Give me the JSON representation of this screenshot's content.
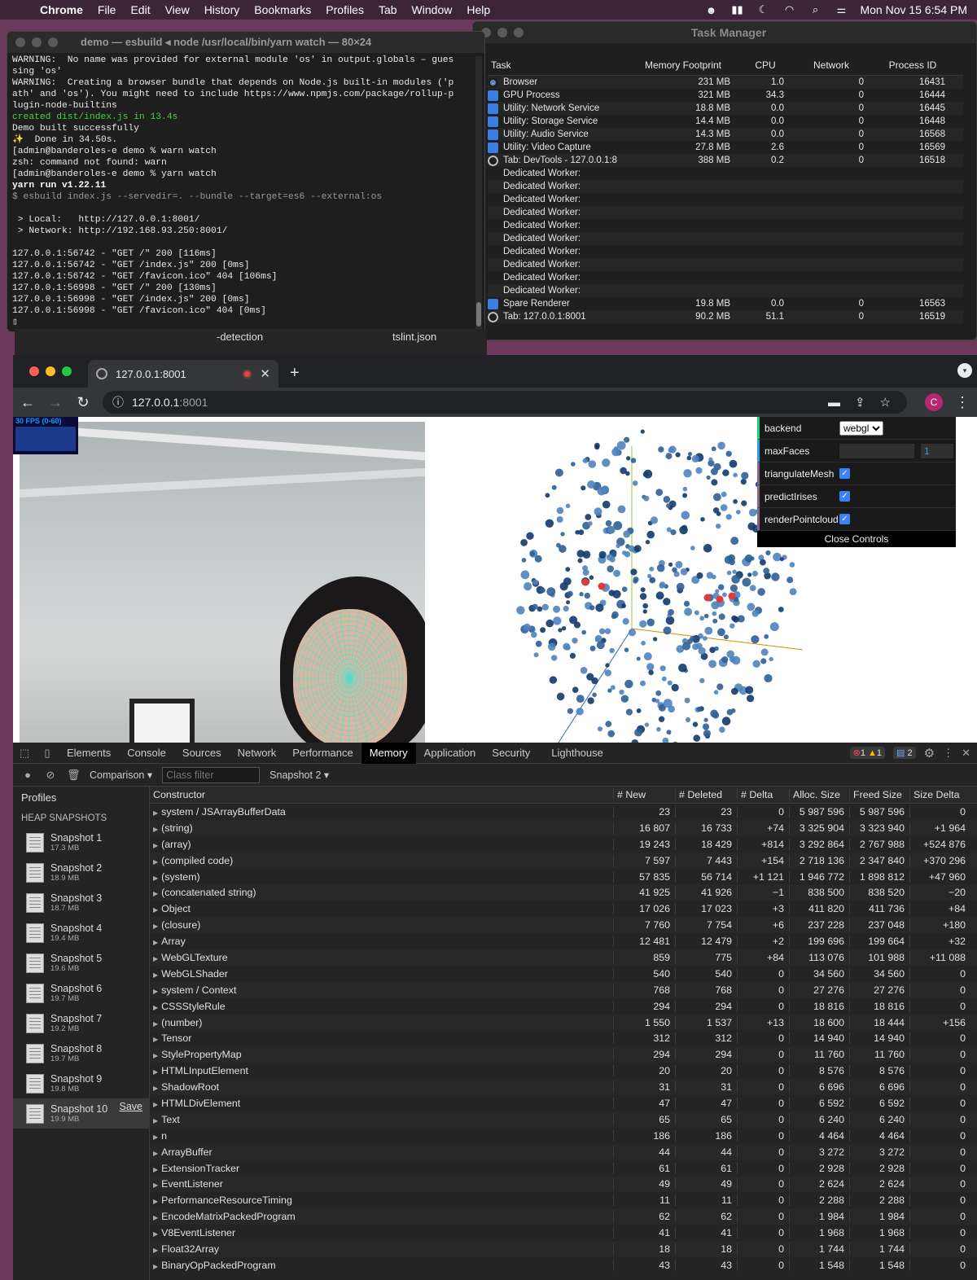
{
  "menubar": {
    "app": "Chrome",
    "items": [
      "File",
      "Edit",
      "View",
      "History",
      "Bookmarks",
      "Profiles",
      "Tab",
      "Window",
      "Help"
    ],
    "clock": "Mon Nov 15  6:54 PM"
  },
  "terminal": {
    "title": "demo — esbuild ◂ node /usr/local/bin/yarn watch — 80×24",
    "lines": [
      {
        "t": "WARNING:  No name was provided for external module 'os' in output.globals – gues",
        "c": ""
      },
      {
        "t": "sing 'os'",
        "c": ""
      },
      {
        "t": "WARNING:  Creating a browser bundle that depends on Node.js built-in modules ('p",
        "c": ""
      },
      {
        "t": "ath' and 'os'). You might need to include https://www.npmjs.com/package/rollup-p",
        "c": ""
      },
      {
        "t": "lugin-node-builtins",
        "c": ""
      },
      {
        "t": "created dist/index.js in 13.4s",
        "c": "t-green"
      },
      {
        "t": "Demo built successfully",
        "c": ""
      },
      {
        "t": "✨  Done in 34.50s.",
        "c": ""
      },
      {
        "t": "[admin@banderoles-e demo % warn watch",
        "c": ""
      },
      {
        "t": "zsh: command not found: warn",
        "c": ""
      },
      {
        "t": "[admin@banderoles-e demo % yarn watch",
        "c": ""
      },
      {
        "t": "yarn run v1.22.11",
        "c": "t-bold"
      },
      {
        "t": "$ esbuild index.js --servedir=. --bundle --target=es6 --external:os",
        "c": "t-gray"
      },
      {
        "t": "",
        "c": ""
      },
      {
        "t": " > Local:   http://127.0.0.1:8001/",
        "c": ""
      },
      {
        "t": " > Network: http://192.168.93.250:8001/",
        "c": ""
      },
      {
        "t": "",
        "c": ""
      },
      {
        "t": "127.0.0.1:56742 - \"GET /\" 200 [116ms]",
        "c": ""
      },
      {
        "t": "127.0.0.1:56742 - \"GET /index.js\" 200 [0ms]",
        "c": ""
      },
      {
        "t": "127.0.0.1:56742 - \"GET /favicon.ico\" 404 [106ms]",
        "c": ""
      },
      {
        "t": "127.0.0.1:56998 - \"GET /\" 200 [130ms]",
        "c": ""
      },
      {
        "t": "127.0.0.1:56998 - \"GET /index.js\" 200 [0ms]",
        "c": ""
      },
      {
        "t": "127.0.0.1:56998 - \"GET /favicon.ico\" 404 [0ms]",
        "c": ""
      },
      {
        "t": "▯",
        "c": ""
      }
    ]
  },
  "taskmgr": {
    "title": "Task Manager",
    "columns": [
      "Task",
      "Memory Footprint",
      "CPU",
      "Network",
      "Process ID"
    ],
    "rows": [
      {
        "icon": "chrome",
        "task": "Browser",
        "mem": "231 MB",
        "cpu": "1.0",
        "net": "0",
        "pid": "16431"
      },
      {
        "icon": "puzzle",
        "task": "GPU Process",
        "mem": "321 MB",
        "cpu": "34.3",
        "net": "0",
        "pid": "16444"
      },
      {
        "icon": "puzzle",
        "task": "Utility: Network Service",
        "mem": "18.8 MB",
        "cpu": "0.0",
        "net": "0",
        "pid": "16445"
      },
      {
        "icon": "puzzle",
        "task": "Utility: Storage Service",
        "mem": "14.4 MB",
        "cpu": "0.0",
        "net": "0",
        "pid": "16448"
      },
      {
        "icon": "puzzle",
        "task": "Utility: Audio Service",
        "mem": "14.3 MB",
        "cpu": "0.0",
        "net": "0",
        "pid": "16568"
      },
      {
        "icon": "puzzle",
        "task": "Utility: Video Capture",
        "mem": "27.8 MB",
        "cpu": "2.6",
        "net": "0",
        "pid": "16569"
      },
      {
        "icon": "globe",
        "task": "Tab: DevTools - 127.0.0.1:8",
        "mem": "388 MB",
        "cpu": "0.2",
        "net": "0",
        "pid": "16518"
      },
      {
        "icon": "none",
        "task": "Dedicated Worker:",
        "mem": "",
        "cpu": "",
        "net": "",
        "pid": ""
      },
      {
        "icon": "none",
        "task": "Dedicated Worker:",
        "mem": "",
        "cpu": "",
        "net": "",
        "pid": ""
      },
      {
        "icon": "none",
        "task": "Dedicated Worker:",
        "mem": "",
        "cpu": "",
        "net": "",
        "pid": ""
      },
      {
        "icon": "none",
        "task": "Dedicated Worker:",
        "mem": "",
        "cpu": "",
        "net": "",
        "pid": ""
      },
      {
        "icon": "none",
        "task": "Dedicated Worker:",
        "mem": "",
        "cpu": "",
        "net": "",
        "pid": ""
      },
      {
        "icon": "none",
        "task": "Dedicated Worker:",
        "mem": "",
        "cpu": "",
        "net": "",
        "pid": ""
      },
      {
        "icon": "none",
        "task": "Dedicated Worker:",
        "mem": "",
        "cpu": "",
        "net": "",
        "pid": ""
      },
      {
        "icon": "none",
        "task": "Dedicated Worker:",
        "mem": "",
        "cpu": "",
        "net": "",
        "pid": ""
      },
      {
        "icon": "none",
        "task": "Dedicated Worker:",
        "mem": "",
        "cpu": "",
        "net": "",
        "pid": ""
      },
      {
        "icon": "none",
        "task": "Dedicated Worker:",
        "mem": "",
        "cpu": "",
        "net": "",
        "pid": ""
      },
      {
        "icon": "puzzle",
        "task": "Spare Renderer",
        "mem": "19.8 MB",
        "cpu": "0.0",
        "net": "0",
        "pid": "16563"
      },
      {
        "icon": "globe",
        "task": "Tab: 127.0.0.1:8001",
        "mem": "90.2 MB",
        "cpu": "51.1",
        "net": "0",
        "pid": "16519"
      }
    ]
  },
  "background": {
    "frag1": "-detection",
    "frag2": "tslint.json"
  },
  "browser": {
    "tab_title": "127.0.0.1:8001",
    "url_host": "127.0.0.1",
    "url_port": ":8001",
    "avatar_letter": "C"
  },
  "demo": {
    "fps_label": "30 FPS (0-60)",
    "controls": {
      "backend_label": "backend",
      "backend_value": "webgl",
      "maxfaces_label": "maxFaces",
      "maxfaces_value": "1",
      "triangulate_label": "triangulateMesh",
      "irises_label": "predictIrises",
      "pointcloud_label": "renderPointcloud",
      "close_label": "Close Controls"
    }
  },
  "devtools": {
    "tabs": [
      "Elements",
      "Console",
      "Sources",
      "Network",
      "Performance",
      "Memory",
      "Application",
      "Security",
      "Lighthouse"
    ],
    "active_tab": "Memory",
    "errors": "1",
    "warnings": "1",
    "messages": "2",
    "view_mode": "Comparison",
    "filter_placeholder": "Class filter",
    "base_snapshot": "Snapshot 2",
    "profiles_title": "Profiles",
    "section_title": "HEAP SNAPSHOTS",
    "save_label": "Save",
    "snapshots": [
      {
        "name": "Snapshot 1",
        "size": "17.3 MB"
      },
      {
        "name": "Snapshot 2",
        "size": "18.9 MB"
      },
      {
        "name": "Snapshot 3",
        "size": "18.7 MB"
      },
      {
        "name": "Snapshot 4",
        "size": "19.4 MB"
      },
      {
        "name": "Snapshot 5",
        "size": "19.6 MB"
      },
      {
        "name": "Snapshot 6",
        "size": "19.7 MB"
      },
      {
        "name": "Snapshot 7",
        "size": "19.2 MB"
      },
      {
        "name": "Snapshot 8",
        "size": "19.7 MB"
      },
      {
        "name": "Snapshot 9",
        "size": "19.8 MB"
      },
      {
        "name": "Snapshot 10",
        "size": "19.9 MB"
      }
    ],
    "columns": [
      "Constructor",
      "# New",
      "# Deleted",
      "# Delta",
      "Alloc. Size",
      "Freed Size",
      "Size Delta"
    ],
    "rows": [
      [
        "system / JSArrayBufferData",
        "23",
        "23",
        "0",
        "5 987 596",
        "5 987 596",
        "0"
      ],
      [
        "(string)",
        "16 807",
        "16 733",
        "+74",
        "3 325 904",
        "3 323 940",
        "+1 964"
      ],
      [
        "(array)",
        "19 243",
        "18 429",
        "+814",
        "3 292 864",
        "2 767 988",
        "+524 876"
      ],
      [
        "(compiled code)",
        "7 597",
        "7 443",
        "+154",
        "2 718 136",
        "2 347 840",
        "+370 296"
      ],
      [
        "(system)",
        "57 835",
        "56 714",
        "+1 121",
        "1 946 772",
        "1 898 812",
        "+47 960"
      ],
      [
        "(concatenated string)",
        "41 925",
        "41 926",
        "−1",
        "838 500",
        "838 520",
        "−20"
      ],
      [
        "Object",
        "17 026",
        "17 023",
        "+3",
        "411 820",
        "411 736",
        "+84"
      ],
      [
        "(closure)",
        "7 760",
        "7 754",
        "+6",
        "237 228",
        "237 048",
        "+180"
      ],
      [
        "Array",
        "12 481",
        "12 479",
        "+2",
        "199 696",
        "199 664",
        "+32"
      ],
      [
        "WebGLTexture",
        "859",
        "775",
        "+84",
        "113 076",
        "101 988",
        "+11 088"
      ],
      [
        "WebGLShader",
        "540",
        "540",
        "0",
        "34 560",
        "34 560",
        "0"
      ],
      [
        "system / Context",
        "768",
        "768",
        "0",
        "27 276",
        "27 276",
        "0"
      ],
      [
        "CSSStyleRule",
        "294",
        "294",
        "0",
        "18 816",
        "18 816",
        "0"
      ],
      [
        "(number)",
        "1 550",
        "1 537",
        "+13",
        "18 600",
        "18 444",
        "+156"
      ],
      [
        "Tensor",
        "312",
        "312",
        "0",
        "14 940",
        "14 940",
        "0"
      ],
      [
        "StylePropertyMap",
        "294",
        "294",
        "0",
        "11 760",
        "11 760",
        "0"
      ],
      [
        "HTMLInputElement",
        "20",
        "20",
        "0",
        "8 576",
        "8 576",
        "0"
      ],
      [
        "ShadowRoot",
        "31",
        "31",
        "0",
        "6 696",
        "6 696",
        "0"
      ],
      [
        "HTMLDivElement",
        "47",
        "47",
        "0",
        "6 592",
        "6 592",
        "0"
      ],
      [
        "Text",
        "65",
        "65",
        "0",
        "6 240",
        "6 240",
        "0"
      ],
      [
        "n",
        "186",
        "186",
        "0",
        "4 464",
        "4 464",
        "0"
      ],
      [
        "ArrayBuffer",
        "44",
        "44",
        "0",
        "3 272",
        "3 272",
        "0"
      ],
      [
        "ExtensionTracker",
        "61",
        "61",
        "0",
        "2 928",
        "2 928",
        "0"
      ],
      [
        "EventListener",
        "49",
        "49",
        "0",
        "2 624",
        "2 624",
        "0"
      ],
      [
        "PerformanceResourceTiming",
        "11",
        "11",
        "0",
        "2 288",
        "2 288",
        "0"
      ],
      [
        "EncodeMatrixPackedProgram",
        "62",
        "62",
        "0",
        "1 984",
        "1 984",
        "0"
      ],
      [
        "V8EventListener",
        "41",
        "41",
        "0",
        "1 968",
        "1 968",
        "0"
      ],
      [
        "Float32Array",
        "18",
        "18",
        "0",
        "1 744",
        "1 744",
        "0"
      ],
      [
        "BinaryOpPackedProgram",
        "43",
        "43",
        "0",
        "1 548",
        "1 548",
        "0"
      ]
    ]
  }
}
